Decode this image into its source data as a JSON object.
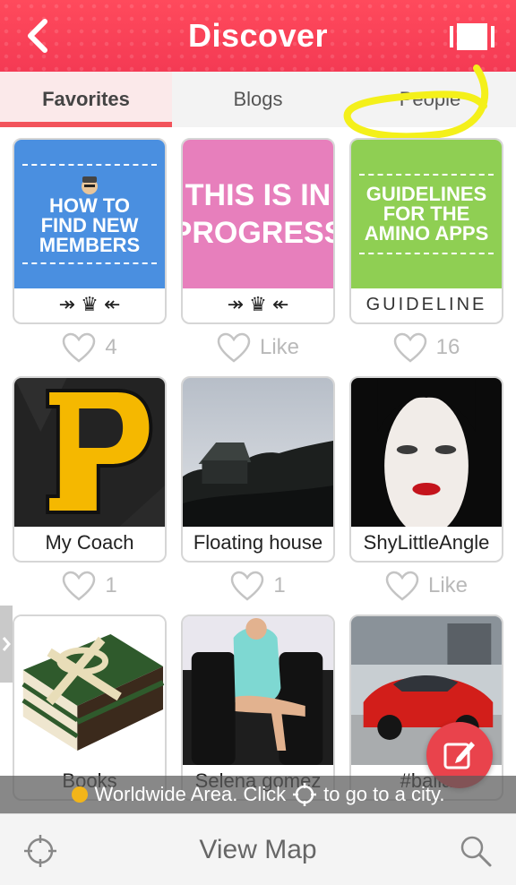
{
  "header": {
    "title": "Discover",
    "back_icon": "chevron-left-icon",
    "cards_icon": "card-stack-icon"
  },
  "tabs": [
    {
      "label": "Favorites",
      "active": true
    },
    {
      "label": "Blogs",
      "active": false
    },
    {
      "label": "People",
      "active": false
    }
  ],
  "cards": [
    {
      "caption": "↠ ♛ ↞",
      "thumb_lines": [
        "HOW TO",
        "FIND NEW",
        "MEMBERS"
      ],
      "thumb_color": "#4a8fe0",
      "likes": "4"
    },
    {
      "caption": "↠ ♛ ↞",
      "thumb_lines": [
        "THIS IS IN",
        "PROGRESS"
      ],
      "thumb_color": "#e77fbc",
      "likes": "Like"
    },
    {
      "caption": "GUIDELINE",
      "thumb_lines": [
        "GUIDELINES",
        "FOR THE",
        "AMINO APPS"
      ],
      "thumb_color": "#8fcf53",
      "likes": "16"
    },
    {
      "caption": "My Coach",
      "likes": "1"
    },
    {
      "caption": "Floating house",
      "likes": "1"
    },
    {
      "caption": "ShyLittleAngle",
      "likes": "Like"
    },
    {
      "caption": "Books"
    },
    {
      "caption": "Selena gomez"
    },
    {
      "caption": "#balla"
    }
  ],
  "banner": {
    "text_before": "Worldwide Area. Click",
    "text_after": "to go to a city."
  },
  "bottom": {
    "view_map": "View Map"
  },
  "colors": {
    "brand": "#f43a54",
    "tab_underline": "#f2535b",
    "fab": "#e9434c",
    "highlight": "#f4f01a"
  }
}
